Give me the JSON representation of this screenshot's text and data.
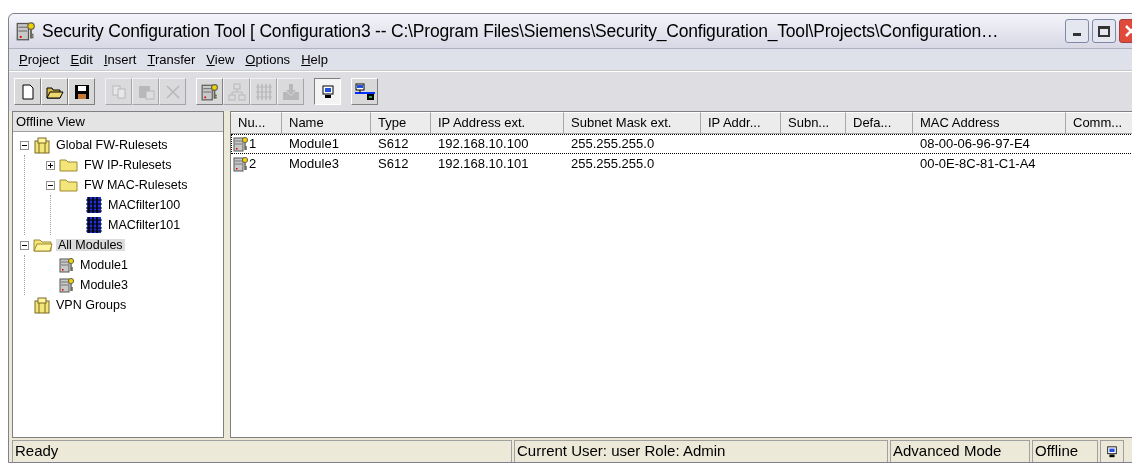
{
  "window": {
    "title": "Security Configuration Tool  [ Configuration3 -- C:\\Program Files\\Siemens\\Security_Configuration_Tool\\Projects\\Configuration…"
  },
  "menu": [
    "Project",
    "Edit",
    "Insert",
    "Transfer",
    "View",
    "Options",
    "Help"
  ],
  "toolbar": [
    {
      "kind": "new",
      "disabled": false,
      "pressed": false
    },
    {
      "kind": "open",
      "disabled": false,
      "pressed": false
    },
    {
      "kind": "save",
      "disabled": false,
      "pressed": false
    },
    {
      "kind": "copy",
      "disabled": true,
      "pressed": false
    },
    {
      "kind": "paste",
      "disabled": true,
      "pressed": false
    },
    {
      "kind": "delete",
      "disabled": true,
      "pressed": false
    },
    {
      "kind": "module",
      "disabled": false,
      "pressed": false
    },
    {
      "kind": "topology",
      "disabled": true,
      "pressed": false
    },
    {
      "kind": "filter",
      "disabled": true,
      "pressed": false
    },
    {
      "kind": "download",
      "disabled": true,
      "pressed": false
    },
    {
      "kind": "offline",
      "disabled": false,
      "pressed": true
    },
    {
      "kind": "network",
      "disabled": false,
      "pressed": false
    }
  ],
  "sidebar": {
    "title": "Offline View",
    "tree": [
      {
        "label": "Global FW-Rulesets",
        "kind": "group",
        "expanded": true,
        "selected": false,
        "children": [
          {
            "label": "FW IP-Rulesets",
            "kind": "folder",
            "expanded": false,
            "selected": false
          },
          {
            "label": "FW MAC-Rulesets",
            "kind": "folder",
            "expanded": true,
            "selected": false,
            "children": [
              {
                "label": "MACfilter100",
                "kind": "filter",
                "selected": false
              },
              {
                "label": "MACfilter101",
                "kind": "filter",
                "selected": false
              }
            ]
          }
        ]
      },
      {
        "label": "All Modules",
        "kind": "openfolder",
        "expanded": true,
        "selected": true,
        "children": [
          {
            "label": "Module1",
            "kind": "module",
            "selected": false
          },
          {
            "label": "Module3",
            "kind": "module",
            "selected": false
          }
        ]
      },
      {
        "label": "VPN Groups",
        "kind": "group",
        "selected": false
      }
    ]
  },
  "table": {
    "columns": [
      "Nu...",
      "Name",
      "Type",
      "IP Address ext.",
      "Subnet Mask ext.",
      "IP Addr...",
      "Subn...",
      "Defa...",
      "MAC Address",
      "Comm..."
    ],
    "rows": [
      {
        "focused": true,
        "cells": [
          "1",
          "Module1",
          "S612",
          "192.168.10.100",
          "255.255.255.0",
          "",
          "",
          "",
          "08-00-06-96-97-E4",
          ""
        ]
      },
      {
        "focused": false,
        "cells": [
          "2",
          "Module3",
          "S612",
          "192.168.10.101",
          "255.255.255.0",
          "",
          "",
          "",
          "00-0E-8C-81-C1-A4",
          ""
        ]
      }
    ]
  },
  "status_bar": [
    "Ready",
    "Current User: user Role: Admin",
    "Advanced Mode",
    "Offline"
  ]
}
